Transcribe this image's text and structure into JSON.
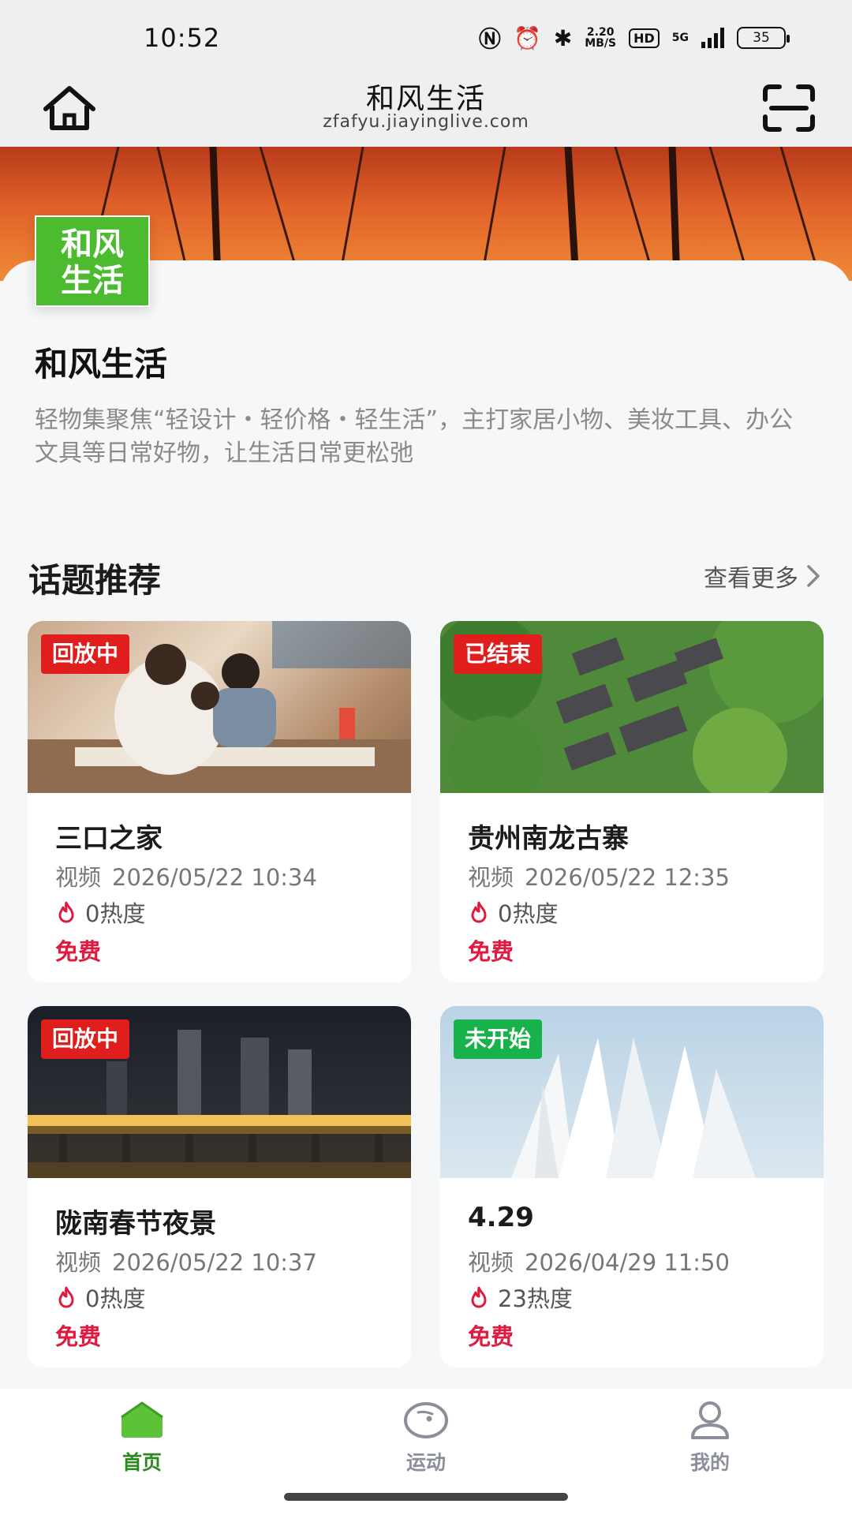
{
  "status_bar": {
    "time": "10:52",
    "net_speed_value": "2.20",
    "net_speed_unit": "MB/S",
    "hd": "HD",
    "network": "5G",
    "battery": "35"
  },
  "header": {
    "title": "和风生活",
    "url": "zfafyu.jiayinglive.com"
  },
  "brand": {
    "logo_line1": "和风",
    "logo_line2": "生活",
    "name": "和风生活",
    "description": "轻物集聚焦“轻设计・轻价格・轻生活”，主打家居小物、美妆工具、办公文具等日常好物，让生活日常更松弛"
  },
  "section": {
    "title": "话题推荐",
    "more": "查看更多"
  },
  "cards": [
    {
      "badge": "回放中",
      "title": "三口之家",
      "type": "视频",
      "datetime": "2026/05/22 10:34",
      "heat": "0热度",
      "price": "免费"
    },
    {
      "badge": "已结束",
      "title": "贵州南龙古寨",
      "type": "视频",
      "datetime": "2026/05/22 12:35",
      "heat": "0热度",
      "price": "免费"
    },
    {
      "badge": "回放中",
      "title": "陇南春节夜景",
      "type": "视频",
      "datetime": "2026/05/22 10:37",
      "heat": "0热度",
      "price": "免费"
    },
    {
      "badge": "未开始",
      "title": "4.29",
      "type": "视频",
      "datetime": "2026/04/29 11:50",
      "heat": "23热度",
      "price": "免费"
    }
  ],
  "nav": {
    "home": "首页",
    "sport": "运动",
    "mine": "我的"
  },
  "colors": {
    "brand_green": "#4cbb2f",
    "badge_red": "#e01e1e",
    "badge_green": "#17b34a",
    "price_red": "#e0193f",
    "nav_active": "#2b8a1d"
  }
}
